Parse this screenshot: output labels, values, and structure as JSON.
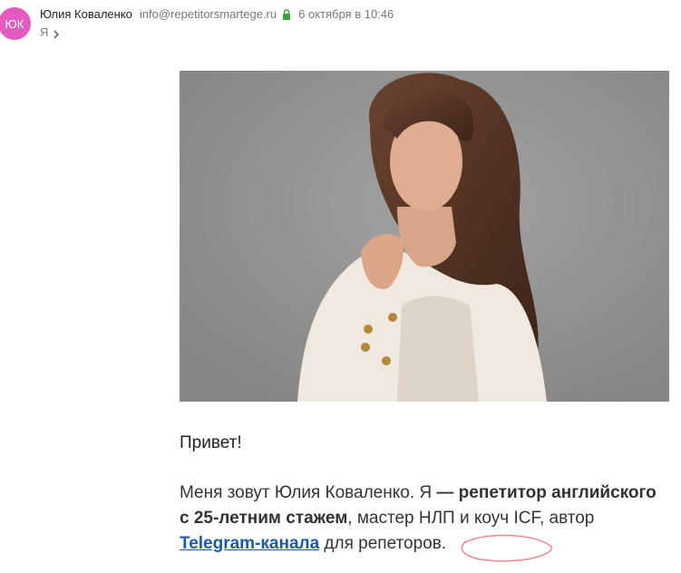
{
  "header": {
    "avatar_initials": "ЮК",
    "avatar_color": "#e35bbf",
    "sender_name": "Юлия Коваленко",
    "sender_email": "info@repetitorsmartege.ru",
    "date": "6 октября в 10:46",
    "recipient": "Я",
    "lock_icon": "lock-icon",
    "lock_color": "#3aa635"
  },
  "body": {
    "greeting": "Привет!",
    "para_part1": "Меня зовут Юлия Коваленко. Я",
    "para_bold1": " — репетитор английского с 25-летним стажем",
    "para_part2": ", мастер НЛП и коуч ICF, автор ",
    "link_text": "Telegram-канала",
    "para_part3": " для репеторов."
  },
  "colors": {
    "link": "#1a5aa6",
    "scribble": "#e06a78"
  }
}
